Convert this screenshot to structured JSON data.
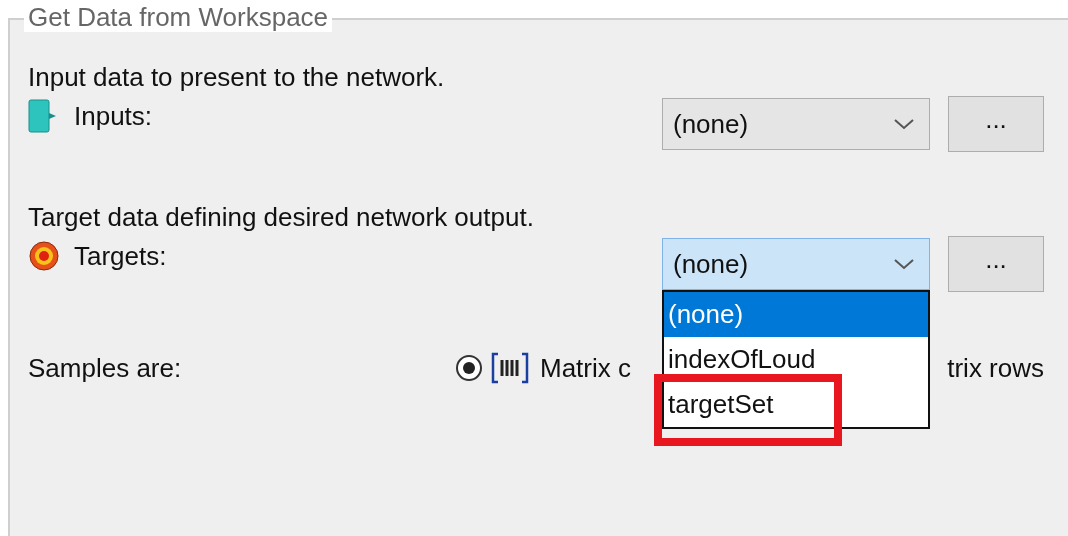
{
  "group": {
    "title": "Get Data from Workspace"
  },
  "inputs": {
    "description": "Input data to present to the network.",
    "label": "Inputs:",
    "value": "(none)",
    "browse": "...",
    "focused": false
  },
  "targets": {
    "description": "Target data defining desired network output.",
    "label": "Targets:",
    "value": "(none)",
    "browse": "...",
    "focused": true,
    "expanded": true,
    "options": [
      {
        "label": "(none)",
        "selected": true,
        "highlighted": false
      },
      {
        "label": "indexOfLoud",
        "selected": false,
        "highlighted": false
      },
      {
        "label": "targetSet",
        "selected": false,
        "highlighted": true
      }
    ]
  },
  "samples": {
    "label": "Samples are:",
    "first_option": {
      "label": "Matrix c",
      "selected": true
    },
    "second_option_text": "trix rows"
  }
}
